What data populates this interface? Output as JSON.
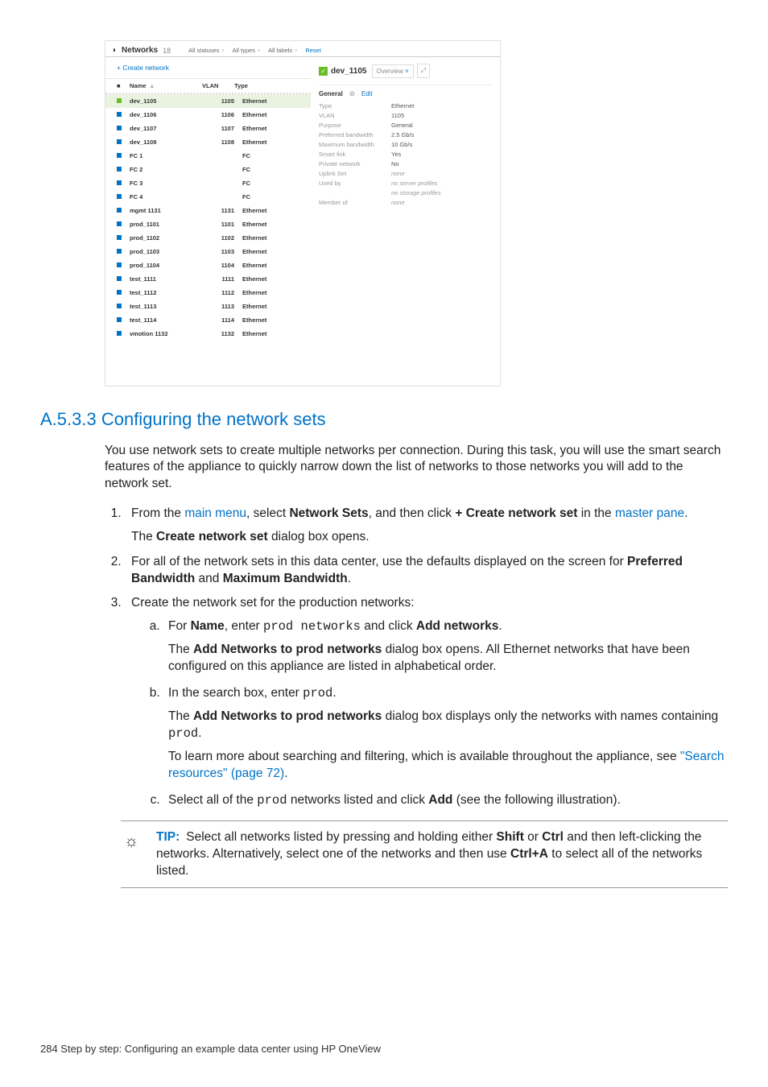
{
  "screenshot": {
    "header": {
      "title": "Networks",
      "count": "18",
      "filters": [
        "All statuses",
        "All types",
        "All labels"
      ],
      "reset": "Reset"
    },
    "create_label": "+  Create network",
    "table_head": {
      "name": "Name",
      "vlan": "VLAN",
      "type": "Type"
    },
    "rows": [
      {
        "color": "green",
        "name": "dev_1105",
        "vlan": "1105",
        "type": "Ethernet",
        "sel": true
      },
      {
        "color": "blue",
        "name": "dev_1106",
        "vlan": "1106",
        "type": "Ethernet"
      },
      {
        "color": "blue",
        "name": "dev_1107",
        "vlan": "1107",
        "type": "Ethernet"
      },
      {
        "color": "blue",
        "name": "dev_1108",
        "vlan": "1108",
        "type": "Ethernet"
      },
      {
        "color": "blue",
        "name": "FC 1",
        "vlan": "",
        "type": "FC"
      },
      {
        "color": "blue",
        "name": "FC 2",
        "vlan": "",
        "type": "FC"
      },
      {
        "color": "blue",
        "name": "FC 3",
        "vlan": "",
        "type": "FC"
      },
      {
        "color": "blue",
        "name": "FC 4",
        "vlan": "",
        "type": "FC"
      },
      {
        "color": "blue",
        "name": "mgmt 1131",
        "vlan": "1131",
        "type": "Ethernet"
      },
      {
        "color": "blue",
        "name": "prod_1101",
        "vlan": "1101",
        "type": "Ethernet"
      },
      {
        "color": "blue",
        "name": "prod_1102",
        "vlan": "1102",
        "type": "Ethernet"
      },
      {
        "color": "blue",
        "name": "prod_1103",
        "vlan": "1103",
        "type": "Ethernet"
      },
      {
        "color": "blue",
        "name": "prod_1104",
        "vlan": "1104",
        "type": "Ethernet"
      },
      {
        "color": "blue",
        "name": "test_1111",
        "vlan": "1111",
        "type": "Ethernet"
      },
      {
        "color": "blue",
        "name": "test_1112",
        "vlan": "1112",
        "type": "Ethernet"
      },
      {
        "color": "blue",
        "name": "test_1113",
        "vlan": "1113",
        "type": "Ethernet"
      },
      {
        "color": "blue",
        "name": "test_1114",
        "vlan": "1114",
        "type": "Ethernet"
      },
      {
        "color": "blue",
        "name": "vmotion 1132",
        "vlan": "1132",
        "type": "Ethernet"
      }
    ],
    "detail": {
      "name": "dev_1105",
      "overview": "Overview",
      "general": "General",
      "edit": "Edit",
      "props": [
        {
          "k": "Type",
          "v": "Ethernet"
        },
        {
          "k": "VLAN",
          "v": "1105"
        },
        {
          "k": "Purpose",
          "v": "General"
        },
        {
          "k": "Preferred bandwidth",
          "v": "2.5 Gb/s"
        },
        {
          "k": "Maximum bandwidth",
          "v": "10 Gb/s"
        },
        {
          "k": "Smart link",
          "v": "Yes"
        },
        {
          "k": "Private network",
          "v": "No"
        },
        {
          "k": "Uplink Set",
          "v": "none",
          "it": true
        },
        {
          "k": "Used by",
          "v": "no server profiles",
          "it": true
        },
        {
          "k": "",
          "v": "no storage profiles",
          "it": true
        },
        {
          "k": "Member of",
          "v": "none",
          "it": true
        }
      ]
    }
  },
  "doc": {
    "section_title": "A.5.3.3 Configuring the network sets",
    "intro": "You use network sets to create multiple networks per connection. During this task, you will use the smart search features of the appliance to quickly narrow down the list of networks to those networks you will add to the network set.",
    "step1_a": "From the ",
    "step1_link1": "main menu",
    "step1_b": ", select ",
    "step1_bold1": "Network Sets",
    "step1_c": ", and then click ",
    "step1_bold2": "+ Create network set",
    "step1_d": " in the ",
    "step1_link2": "master pane",
    "step1_e": ".",
    "step1_result_a": "The ",
    "step1_result_bold": "Create network set",
    "step1_result_b": " dialog box opens.",
    "step2_a": "For all of the network sets in this data center, use the defaults displayed on the screen for ",
    "step2_bold1": "Preferred Bandwidth",
    "step2_b": " and ",
    "step2_bold2": "Maximum Bandwidth",
    "step2_c": ".",
    "step3": "Create the network set for the production networks:",
    "step3a_a": "For ",
    "step3a_bold1": "Name",
    "step3a_b": ", enter ",
    "step3a_mono": "prod networks",
    "step3a_c": " and click ",
    "step3a_bold2": "Add networks",
    "step3a_d": ".",
    "step3a_res_a": "The ",
    "step3a_res_bold": "Add Networks to prod networks",
    "step3a_res_b": " dialog box opens. All Ethernet networks that have been configured on this appliance are listed in alphabetical order.",
    "step3b_a": "In the search box, enter ",
    "step3b_mono": "prod",
    "step3b_b": ".",
    "step3b_res_a": "The ",
    "step3b_res_bold": "Add Networks to prod networks",
    "step3b_res_b": " dialog box displays only the networks with names containing ",
    "step3b_res_mono": "prod",
    "step3b_res_c": ".",
    "step3b_more_a": "To learn more about searching and filtering, which is available throughout the appliance, see ",
    "step3b_more_link": "\"Search resources\" (page 72)",
    "step3b_more_b": ".",
    "step3c_a": "Select all of the ",
    "step3c_mono": "prod",
    "step3c_b": " networks listed and click ",
    "step3c_bold": "Add",
    "step3c_c": " (see the following illustration).",
    "tip_label": "TIP:",
    "tip_a": "Select all networks listed by pressing and holding either ",
    "tip_bold1": "Shift",
    "tip_b": " or ",
    "tip_bold2": "Ctrl",
    "tip_c": " and then left-clicking the networks. Alternatively, select one of the networks and then use ",
    "tip_bold3": "Ctrl+A",
    "tip_d": " to select all of the networks listed.",
    "footer": "284   Step by step: Configuring an example data center using HP OneView"
  }
}
